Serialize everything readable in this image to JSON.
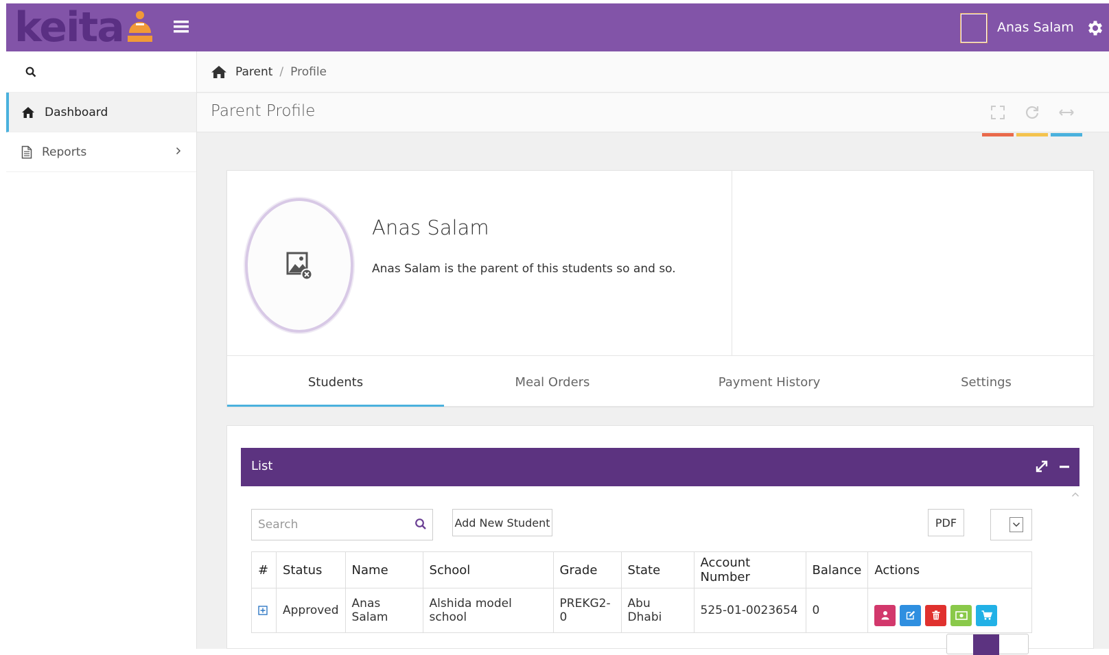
{
  "app": {
    "logo_text": "keita",
    "user_name": "Anas Salam"
  },
  "sidebar": {
    "items": [
      {
        "label": "Dashboard"
      },
      {
        "label": "Reports"
      }
    ]
  },
  "breadcrumb": {
    "parent": "Parent",
    "separator": "/",
    "current": "Profile"
  },
  "page": {
    "title": "Parent Profile",
    "tool_colors": [
      "#e96a4b",
      "#f4c34e",
      "#4ab1dd"
    ]
  },
  "profile": {
    "name": "Anas Salam",
    "description": "Anas Salam is the parent of this students so and so."
  },
  "tabs": [
    {
      "label": "Students",
      "active": true
    },
    {
      "label": "Meal Orders",
      "active": false
    },
    {
      "label": "Payment History",
      "active": false
    },
    {
      "label": "Settings",
      "active": false
    }
  ],
  "list": {
    "title": "List",
    "search_placeholder": "Search",
    "add_label": "Add New Student",
    "pdf_label": "PDF",
    "columns": [
      "#",
      "Status",
      "Name",
      "School",
      "Grade",
      "State",
      "Account Number",
      "Balance",
      "Actions"
    ],
    "rows": [
      {
        "status": "Approved",
        "name": "Anas Salam",
        "school": "Alshida model school",
        "grade": "PREKG2-0",
        "state": "Abu Dhabi",
        "account": "525-01-0023654",
        "balance": "0"
      }
    ],
    "action_colors": [
      "#d2386c",
      "#2f8fe0",
      "#e0312e",
      "#8ac94a",
      "#22b1e6"
    ]
  },
  "colors": {
    "topbar": "#8254a8",
    "list_header": "#5c3380",
    "accent": "#4ab1dd",
    "logo_orange": "#f19a37"
  }
}
